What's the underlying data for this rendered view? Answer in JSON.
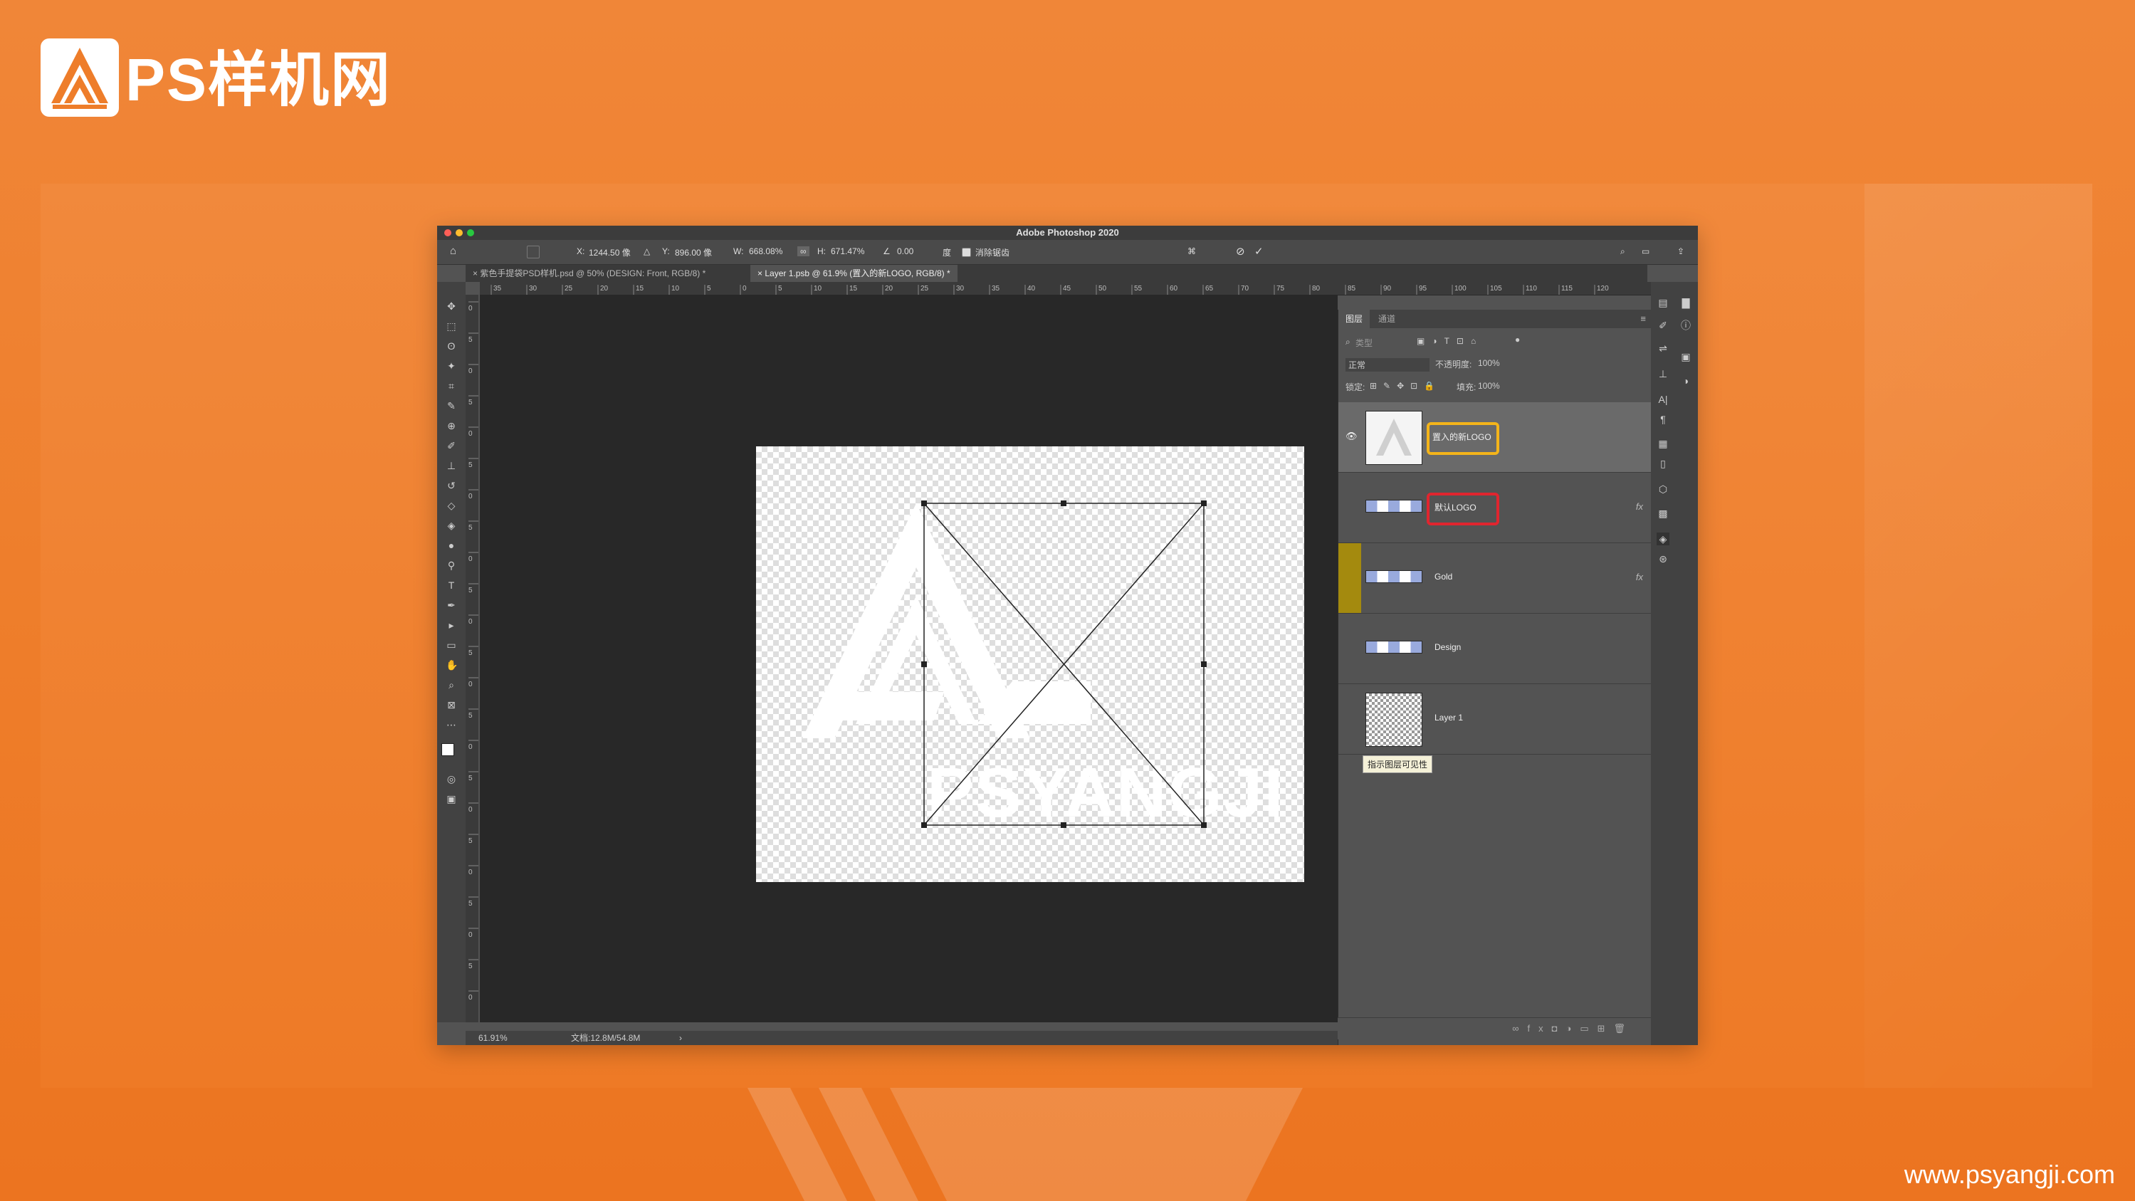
{
  "brand": {
    "name": "PS样机网",
    "url": "www.psyangji.com"
  },
  "window": {
    "title": "Adobe Photoshop 2020",
    "colors": {
      "close": "#fe5f57",
      "minimize": "#febc2e",
      "maximize": "#28c840",
      "accent_yellow": "#f4b41a",
      "accent_red": "#e0252f"
    }
  },
  "options_bar": {
    "x_label": "X:",
    "x_value": "1244.50 像",
    "y_label": "Y:",
    "y_value": "896.00 像",
    "w_label": "W:",
    "w_value": "668.08%",
    "h_label": "H:",
    "h_value": "671.47%",
    "angle_value": "0.00",
    "angle_unit": "度",
    "antialias_label": "消除锯齿"
  },
  "tabs": [
    {
      "label": "紫色手提袋PSD样机.psd @ 50% (DESIGN: Front, RGB/8) *"
    },
    {
      "label": "Layer 1.psb @ 61.9% (置入的新LOGO, RGB/8) *"
    }
  ],
  "ruler_h": [
    "35",
    "30",
    "25",
    "20",
    "15",
    "10",
    "5",
    "0",
    "5",
    "10",
    "15",
    "20",
    "25",
    "30",
    "35",
    "40",
    "45",
    "50",
    "55",
    "60",
    "65",
    "70",
    "75",
    "80",
    "85",
    "90",
    "95",
    "100",
    "105",
    "110",
    "115",
    "120"
  ],
  "ruler_v": [
    "0",
    "5",
    "0",
    "5",
    "0",
    "5",
    "0",
    "5",
    "0",
    "5",
    "0",
    "5",
    "0",
    "5",
    "0",
    "5",
    "0",
    "5",
    "0",
    "5",
    "0",
    "5",
    "0"
  ],
  "canvas": {
    "logo_text": "PSYANGJI"
  },
  "status": {
    "zoom": "61.91%",
    "doc": "文档:12.8M/54.8M"
  },
  "layers_panel": {
    "tabs": [
      "图层",
      "通道"
    ],
    "search_placeholder": "类型",
    "blend_mode": "正常",
    "opacity_label": "不透明度:",
    "opacity_value": "100%",
    "lock_label": "锁定:",
    "fill_label": "填充:",
    "fill_value": "100%",
    "layers": [
      {
        "name": "置入的新LOGO",
        "visible": true,
        "selected": true,
        "highlight": "yellow"
      },
      {
        "name": "默认LOGO",
        "fx": "fx",
        "highlight": "red"
      },
      {
        "name": "Gold",
        "fx": "fx",
        "tag_color": "#a48a0e"
      },
      {
        "name": "Design"
      },
      {
        "name": "Layer 1"
      }
    ],
    "tooltip": "指示图层可见性"
  }
}
